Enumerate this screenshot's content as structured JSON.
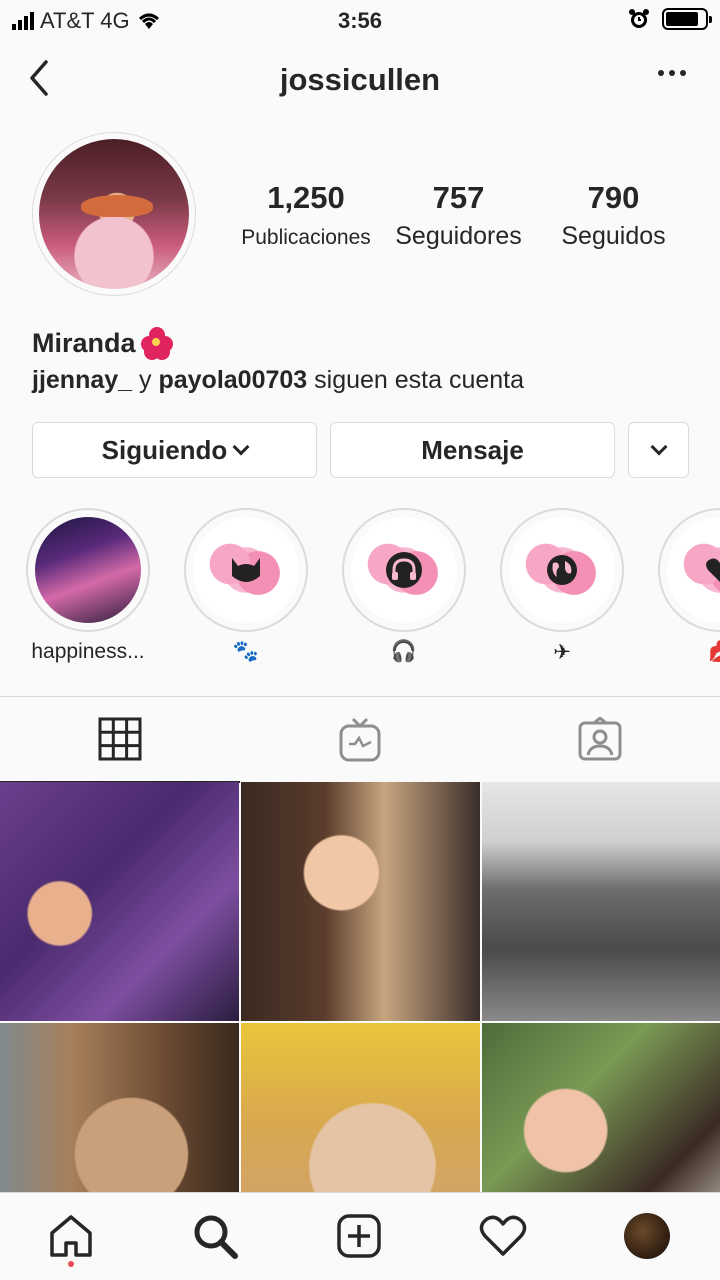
{
  "status_bar": {
    "carrier": "AT&T 4G",
    "time": "3:56",
    "battery_level": 0.85
  },
  "nav": {
    "username": "jossicullen",
    "back_icon": "chevron-left-icon",
    "more_icon": "more-horizontal-icon"
  },
  "profile": {
    "name": "Miranda",
    "name_emoji_icon": "hibiscus-icon",
    "stats": {
      "posts_count": "1,250",
      "posts_label": "Publicaciones",
      "followers_count": "757",
      "followers_label": "Seguidores",
      "following_count": "790",
      "following_label": "Seguidos"
    },
    "followed_by": {
      "user1": "jjennay_",
      "conjunction": " y ",
      "user2": "payola00703",
      "suffix": " siguen esta cuenta"
    }
  },
  "actions": {
    "following_label": "Siguiendo",
    "message_label": "Mensaje"
  },
  "highlights": [
    {
      "label": "happiness...",
      "icon": "photo"
    },
    {
      "label": "🐾",
      "icon": "cat-icon"
    },
    {
      "label": "🎧",
      "icon": "headphones-icon"
    },
    {
      "label": "✈",
      "icon": "globe-icon"
    },
    {
      "label": "💋",
      "icon": "heart-icon"
    }
  ],
  "tabs": [
    {
      "name": "grid",
      "icon": "grid-icon",
      "active": true
    },
    {
      "name": "igtv",
      "icon": "igtv-icon",
      "active": false
    },
    {
      "name": "tagged",
      "icon": "tagged-icon",
      "active": false
    }
  ],
  "posts": [
    "concert selfie",
    "selfie with glasses",
    "mountain view",
    "cat close-up",
    "sleeping cat",
    "outdoor selfie"
  ],
  "bottom_bar": [
    "home-icon",
    "search-icon",
    "add-icon",
    "heart-icon",
    "profile-avatar"
  ],
  "colors": {
    "text": "#262626",
    "border": "#dbdbdb",
    "background": "#fafafa",
    "notification": "#ed4956",
    "highlight_pink": "#f48fb5"
  }
}
